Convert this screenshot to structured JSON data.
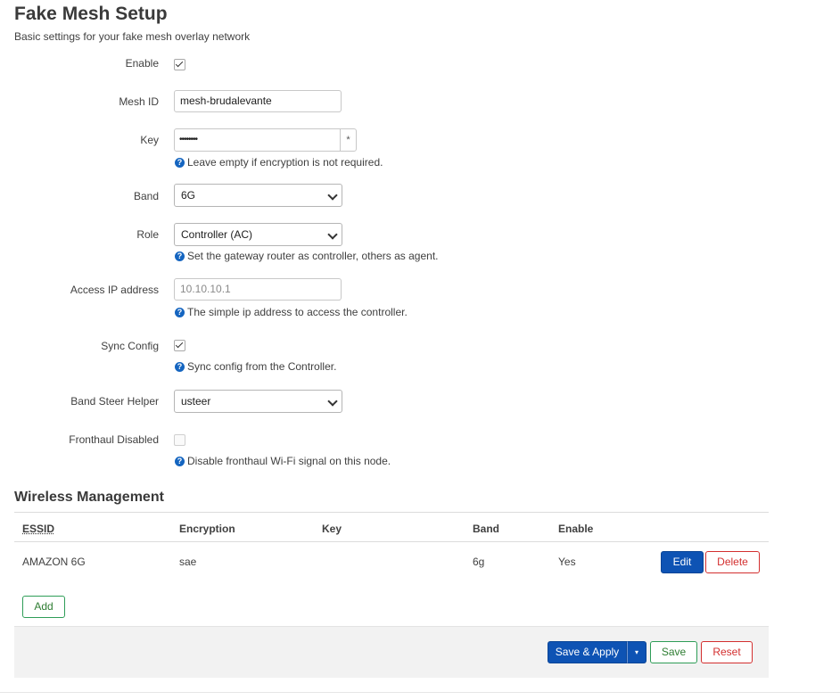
{
  "page": {
    "title": "Fake Mesh Setup",
    "description": "Basic settings for your fake mesh overlay network"
  },
  "form": {
    "enable": {
      "label": "Enable",
      "checked": true
    },
    "mesh_id": {
      "label": "Mesh ID",
      "value": "mesh-brudalevante"
    },
    "key": {
      "label": "Key",
      "value_masked": "••••••••",
      "reveal_glyph": "*",
      "hint": "Leave empty if encryption is not required."
    },
    "band": {
      "label": "Band",
      "selected": "6G"
    },
    "role": {
      "label": "Role",
      "selected": "Controller (AC)",
      "hint": "Set the gateway router as controller, others as agent."
    },
    "access_ip": {
      "label": "Access IP address",
      "placeholder": "10.10.10.1",
      "hint": "The simple ip address to access the controller."
    },
    "sync_config": {
      "label": "Sync Config",
      "checked": true,
      "hint": "Sync config from the Controller."
    },
    "band_steer": {
      "label": "Band Steer Helper",
      "selected": "usteer"
    },
    "fronthaul_disabled": {
      "label": "Fronthaul Disabled",
      "checked": false,
      "hint": "Disable fronthaul Wi-Fi signal on this node."
    }
  },
  "hint_icon": "?",
  "wireless": {
    "title": "Wireless Management",
    "columns": {
      "essid": "ESSID",
      "encryption": "Encryption",
      "key": "Key",
      "band": "Band",
      "enable": "Enable"
    },
    "rows": [
      {
        "essid": "AMAZON 6G",
        "encryption": "sae",
        "key": "",
        "band": "6g",
        "enable": "Yes",
        "edit_label": "Edit",
        "delete_label": "Delete"
      }
    ],
    "add_label": "Add"
  },
  "footer": {
    "save_apply_label": "Save & Apply",
    "menu_glyph": "▾",
    "save_label": "Save",
    "reset_label": "Reset"
  },
  "colors": {
    "primary": "#0e53b4",
    "positive": "#2e9d57",
    "negative": "#d32f2f",
    "hint_icon": "#1565c0"
  }
}
